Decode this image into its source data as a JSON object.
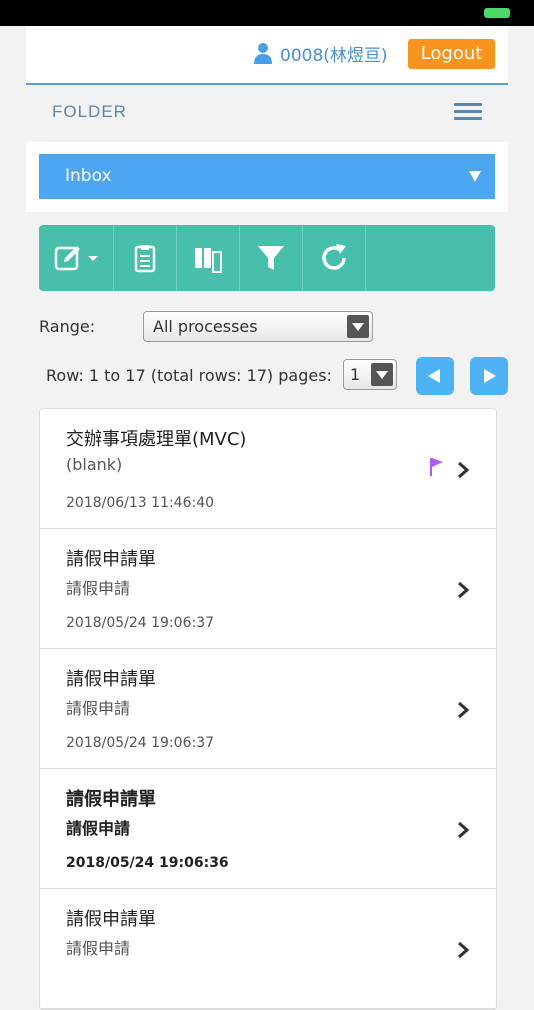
{
  "header": {
    "user": "0008(林煜亘)",
    "logout": "Logout"
  },
  "folder": {
    "title": "FOLDER",
    "selected": "Inbox"
  },
  "toolbar": {
    "buttons": [
      "compose",
      "clipboard",
      "copy",
      "filter",
      "refresh"
    ]
  },
  "range": {
    "label": "Range:",
    "value": "All processes"
  },
  "pagination": {
    "text": "Row: 1 to 17 (total rows: 17) pages:",
    "page": "1"
  },
  "items": [
    {
      "title": "交辦事項處理單(MVC)",
      "sub": "(blank)",
      "date": "2018/06/13 11:46:40",
      "flag": true
    },
    {
      "title": "請假申請單",
      "sub": "請假申請",
      "date": "2018/05/24 19:06:37"
    },
    {
      "title": "請假申請單",
      "sub": "請假申請",
      "date": "2018/05/24 19:06:37"
    },
    {
      "title": "請假申請單",
      "sub": "請假申請",
      "date": "2018/05/24 19:06:36",
      "bold": true
    },
    {
      "title": "請假申請單",
      "sub": "請假申請",
      "date": ""
    }
  ],
  "colors": {
    "accent": "#4da6f0",
    "toolbar": "#48bfab",
    "logout": "#f7941d",
    "flag": "#b05cf0"
  }
}
